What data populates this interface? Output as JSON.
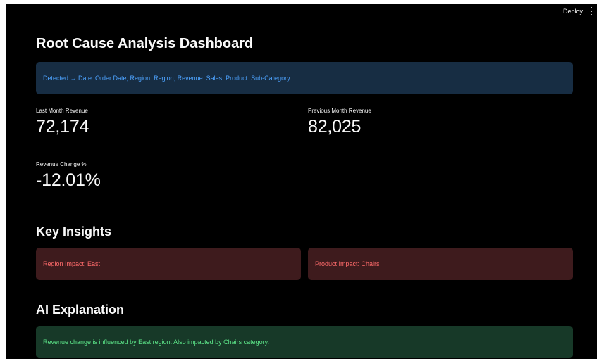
{
  "header": {
    "deploy_label": "Deploy"
  },
  "page": {
    "title": "Root Cause Analysis Dashboard",
    "detected_info": "Detected → Date: Order Date, Region: Region, Revenue: Sales, Product: Sub-Category"
  },
  "metrics": [
    {
      "label": "Last Month Revenue",
      "value": "72,174"
    },
    {
      "label": "Previous Month Revenue",
      "value": "82,025"
    },
    {
      "label": "Revenue Change %",
      "value": "-12.01%"
    }
  ],
  "insights": {
    "heading": "Key Insights",
    "region_impact": "Region Impact: East",
    "product_impact": "Product Impact: Chairs"
  },
  "explanation": {
    "heading": "AI Explanation",
    "text": "Revenue change is influenced by East region. Also impacted by Chairs category."
  },
  "colors": {
    "background": "#000000",
    "info_bg": "#172d43",
    "info_text": "#4da3ff",
    "error_bg": "#3e1b1d",
    "error_text": "#ff6b6b",
    "success_bg": "#173928",
    "success_text": "#5ce488"
  }
}
